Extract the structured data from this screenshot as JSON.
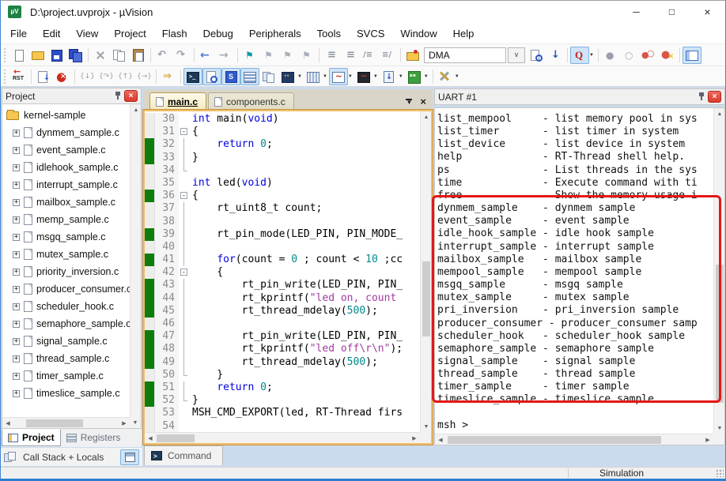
{
  "window": {
    "title": "D:\\project.uvprojx - µVision",
    "status": "Simulation",
    "controls": {
      "minimize": "─",
      "maximize": "□",
      "close": "×"
    }
  },
  "menu": {
    "items": [
      "File",
      "Edit",
      "View",
      "Project",
      "Flash",
      "Debug",
      "Peripherals",
      "Tools",
      "SVCS",
      "Window",
      "Help"
    ]
  },
  "toolbar1": {
    "items": [
      {
        "name": "new-file"
      },
      {
        "name": "open-file"
      },
      {
        "name": "save"
      },
      {
        "name": "save-all"
      },
      {
        "sep": true
      },
      {
        "name": "cut"
      },
      {
        "name": "copy"
      },
      {
        "name": "paste"
      },
      {
        "sep": true
      },
      {
        "name": "undo"
      },
      {
        "name": "redo"
      },
      {
        "sep": true
      },
      {
        "name": "nav-back"
      },
      {
        "name": "nav-forward"
      },
      {
        "sep": true
      },
      {
        "name": "bookmark-toggle"
      },
      {
        "name": "bookmark-next"
      },
      {
        "name": "bookmark-prev"
      },
      {
        "name": "bookmark-clear"
      },
      {
        "sep": true
      },
      {
        "name": "indent"
      },
      {
        "name": "outdent"
      },
      {
        "name": "comment"
      },
      {
        "name": "uncomment"
      },
      {
        "sep": true
      },
      {
        "name": "flash-config"
      },
      {
        "combo": true,
        "value": "DMA"
      },
      {
        "name": "find-in-files"
      },
      {
        "name": "incremental-find"
      },
      {
        "sep": true
      },
      {
        "name": "quick-find",
        "hl": true,
        "dd": true
      },
      {
        "sep": true
      },
      {
        "name": "toggle-breakpoint"
      },
      {
        "name": "enable-disable-breakpoint"
      },
      {
        "name": "disable-all-breakpoints"
      },
      {
        "name": "kill-all-breakpoints"
      },
      {
        "sep": true
      },
      {
        "name": "windows-layout",
        "hl": true
      }
    ],
    "target_select_value": "DMA"
  },
  "toolbar2": {
    "items": [
      {
        "name": "reset"
      },
      {
        "sep": true
      },
      {
        "name": "run"
      },
      {
        "name": "stop"
      },
      {
        "sep": true
      },
      {
        "name": "step-into"
      },
      {
        "name": "step-over"
      },
      {
        "name": "step-out"
      },
      {
        "name": "run-to-cursor"
      },
      {
        "sep": true
      },
      {
        "name": "show-next-statement"
      },
      {
        "sep": true
      },
      {
        "name": "command-window",
        "hl": true
      },
      {
        "name": "disassembly-window",
        "hl": true
      },
      {
        "name": "symbol-window",
        "hl": true
      },
      {
        "name": "registers-window",
        "hl": true
      },
      {
        "name": "callstack-window"
      },
      {
        "name": "watch-window",
        "dd": true
      },
      {
        "name": "memory-window",
        "dd": true
      },
      {
        "name": "serial-window",
        "hl": true,
        "dd": true
      },
      {
        "name": "analysis-window",
        "dd": true
      },
      {
        "name": "trace-window",
        "dd": true
      },
      {
        "name": "system-viewer",
        "dd": true
      },
      {
        "sep": true
      },
      {
        "name": "toolbox",
        "dd": true
      }
    ]
  },
  "project_panel": {
    "title": "Project",
    "root": "kernel-sample",
    "files": [
      "dynmem_sample.c",
      "event_sample.c",
      "idlehook_sample.c",
      "interrupt_sample.c",
      "mailbox_sample.c",
      "memp_sample.c",
      "msgq_sample.c",
      "mutex_sample.c",
      "priority_inversion.c",
      "producer_consumer.c",
      "scheduler_hook.c",
      "semaphore_sample.c",
      "signal_sample.c",
      "thread_sample.c",
      "timer_sample.c",
      "timeslice_sample.c"
    ],
    "tabs": [
      "Project",
      "Registers"
    ],
    "callstack_label": "Call Stack + Locals"
  },
  "editor": {
    "tabs": [
      {
        "label": "main.c",
        "active": true
      },
      {
        "label": "components.c",
        "active": false
      }
    ],
    "command_tab": "Command",
    "lines": [
      {
        "n": 30,
        "cov": 0,
        "f": "",
        "s": [
          [
            "k",
            "int"
          ],
          [
            "p",
            " main("
          ],
          [
            "k",
            "void"
          ],
          [
            "p",
            ")"
          ]
        ]
      },
      {
        "n": 31,
        "cov": 0,
        "f": "o",
        "s": [
          [
            "p",
            "{"
          ]
        ]
      },
      {
        "n": 32,
        "cov": 1,
        "f": "l",
        "s": [
          [
            "p",
            "    "
          ],
          [
            "k",
            "return"
          ],
          [
            "p",
            " "
          ],
          [
            "n",
            "0"
          ],
          [
            "p",
            ";"
          ]
        ]
      },
      {
        "n": 33,
        "cov": 1,
        "f": "l",
        "s": [
          [
            "p",
            "}"
          ]
        ]
      },
      {
        "n": 34,
        "cov": 0,
        "f": "e",
        "s": []
      },
      {
        "n": 35,
        "cov": 0,
        "f": "",
        "s": [
          [
            "k",
            "int"
          ],
          [
            "p",
            " led("
          ],
          [
            "k",
            "void"
          ],
          [
            "p",
            ")"
          ]
        ]
      },
      {
        "n": 36,
        "cov": 1,
        "f": "o",
        "s": [
          [
            "p",
            "{"
          ]
        ]
      },
      {
        "n": 37,
        "cov": 0,
        "f": "l",
        "s": [
          [
            "p",
            "    rt_uint8_t count;"
          ]
        ]
      },
      {
        "n": 38,
        "cov": 0,
        "f": "l",
        "s": []
      },
      {
        "n": 39,
        "cov": 1,
        "f": "l",
        "s": [
          [
            "p",
            "    rt_pin_mode(LED_PIN, PIN_MODE_"
          ]
        ]
      },
      {
        "n": 40,
        "cov": 0,
        "f": "l",
        "s": []
      },
      {
        "n": 41,
        "cov": 1,
        "f": "l",
        "s": [
          [
            "p",
            "    "
          ],
          [
            "k",
            "for"
          ],
          [
            "p",
            "(count = "
          ],
          [
            "n",
            "0"
          ],
          [
            "p",
            " ; count < "
          ],
          [
            "n",
            "10"
          ],
          [
            "p",
            " ;cc"
          ]
        ]
      },
      {
        "n": 42,
        "cov": 0,
        "f": "o",
        "s": [
          [
            "p",
            "    {"
          ]
        ]
      },
      {
        "n": 43,
        "cov": 1,
        "f": "l",
        "s": [
          [
            "p",
            "        rt_pin_write(LED_PIN, PIN_"
          ]
        ]
      },
      {
        "n": 44,
        "cov": 1,
        "f": "l",
        "s": [
          [
            "p",
            "        rt_kprintf("
          ],
          [
            "s",
            "\"led on, count"
          ]
        ]
      },
      {
        "n": 45,
        "cov": 1,
        "f": "l",
        "s": [
          [
            "p",
            "        rt_thread_mdelay("
          ],
          [
            "n",
            "500"
          ],
          [
            "p",
            ");"
          ]
        ]
      },
      {
        "n": 46,
        "cov": 0,
        "f": "l",
        "s": []
      },
      {
        "n": 47,
        "cov": 1,
        "f": "l",
        "s": [
          [
            "p",
            "        rt_pin_write(LED_PIN, PIN_"
          ]
        ]
      },
      {
        "n": 48,
        "cov": 1,
        "f": "l",
        "s": [
          [
            "p",
            "        rt_kprintf("
          ],
          [
            "s",
            "\"led off\\r\\n\""
          ],
          [
            "p",
            ");"
          ]
        ]
      },
      {
        "n": 49,
        "cov": 1,
        "f": "l",
        "s": [
          [
            "p",
            "        rt_thread_mdelay("
          ],
          [
            "n",
            "500"
          ],
          [
            "p",
            ");"
          ]
        ]
      },
      {
        "n": 50,
        "cov": 0,
        "f": "e",
        "s": [
          [
            "p",
            "    }"
          ]
        ]
      },
      {
        "n": 51,
        "cov": 1,
        "f": "l",
        "s": [
          [
            "p",
            "    "
          ],
          [
            "k",
            "return"
          ],
          [
            "p",
            " "
          ],
          [
            "n",
            "0"
          ],
          [
            "p",
            ";"
          ]
        ]
      },
      {
        "n": 52,
        "cov": 1,
        "f": "e",
        "s": [
          [
            "p",
            "}"
          ]
        ]
      },
      {
        "n": 53,
        "cov": 0,
        "f": "",
        "s": [
          [
            "p",
            "MSH_CMD_EXPORT(led, RT-Thread firs"
          ]
        ]
      },
      {
        "n": 54,
        "cov": 0,
        "f": "",
        "s": []
      }
    ]
  },
  "uart_panel": {
    "title": "UART #1",
    "lines": [
      "list_mempool     - list memory pool in sys",
      "list_timer       - list timer in system",
      "list_device      - list device in system",
      "help             - RT-Thread shell help.",
      "ps               - List threads in the sys",
      "time             - Execute command with ti",
      "free             - Show the memory usage i",
      "dynmem_sample    - dynmem sample",
      "event_sample     - event sample",
      "idle_hook_sample - idle hook sample",
      "interrupt_sample - interrupt sample",
      "mailbox_sample   - mailbox sample",
      "mempool_sample   - mempool sample",
      "msgq_sample      - msgq sample",
      "mutex_sample     - mutex sample",
      "pri_inversion    - pri_inversion sample",
      "producer_consumer - producer_consumer samp",
      "scheduler_hook   - scheduler_hook sample",
      "semaphore_sample - semaphore sample",
      "signal_sample    - signal sample",
      "thread_sample    - thread sample",
      "timer_sample     - timer sample",
      "timeslice_sample - timeslice sample",
      "",
      "msh >"
    ]
  },
  "colors": {
    "annotation_red": "#e51616",
    "coverage_green": "#0d7e0e",
    "keyword_blue": "#0000e0",
    "number_teal": "#008a8a",
    "string_purple": "#a03aa0",
    "panel_close_red": "#d93a2b",
    "toolbar_highlight": "#cfe4f7",
    "editor_border_orange": "#eec06a"
  }
}
